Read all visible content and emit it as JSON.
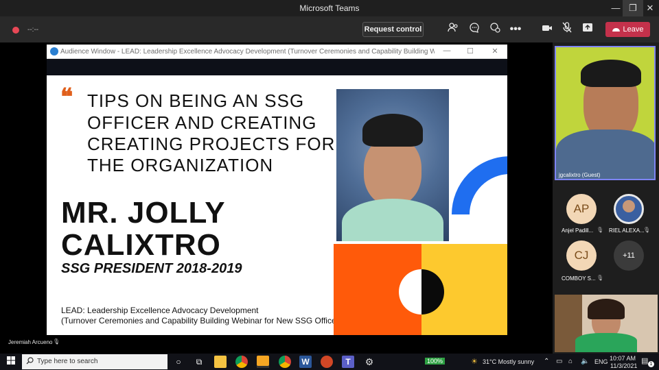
{
  "window": {
    "title": "Microsoft Teams",
    "minimize_glyph": "—",
    "restore_glyph": "❐",
    "close_glyph": "✕"
  },
  "toolbar": {
    "timer": "--:--",
    "request_control_label": "Request control",
    "leave_label": "Leave",
    "leave_color": "#c4314b"
  },
  "audience_window": {
    "title": "Audience Window - LEAD: Leadership Excellence Advocacy Development (Turnover Ceremonies and Capability Building Webinar for ...",
    "controls": [
      "—",
      "☐",
      "✕"
    ]
  },
  "slide": {
    "heading_lines": [
      "TIPS ON BEING AN SSG",
      "OFFICER AND CREATING",
      "CREATING PROJECTS FOR",
      "THE ORGANIZATION"
    ],
    "speaker_lines": [
      "MR. JOLLY",
      "CALIXTRO"
    ],
    "role": "SSG PRESIDENT 2018-2019",
    "footer_lines": [
      "LEAD: Leadership Excellence Advocacy Development",
      "(Turnover Ceremonies and Capability Building Webinar for New SSG Officers)"
    ],
    "accent_color": "#e0601c",
    "colors": {
      "orange": "#ff5a0a",
      "yellow": "#fdc92e",
      "blue": "#1f6ef0"
    }
  },
  "presenter_label": "Jeremiah Arcueno",
  "participants": {
    "main_video_label": "jgcalixtro (Guest)",
    "tiles": [
      {
        "initials": "AP",
        "name": "Anjel Padill..."
      },
      {
        "initials": "",
        "name": "RIEL ALEXA..."
      },
      {
        "initials": "CJ",
        "name": "COMBOY S..."
      },
      {
        "initials": "+11",
        "name": ""
      }
    ]
  },
  "taskbar": {
    "search_placeholder": "Type here to search",
    "battery_badge": "100%",
    "weather": "31°C  Mostly sunny",
    "language": "ENG",
    "time": "10:07 AM",
    "date": "11/3/2021",
    "notification_count": "1"
  }
}
